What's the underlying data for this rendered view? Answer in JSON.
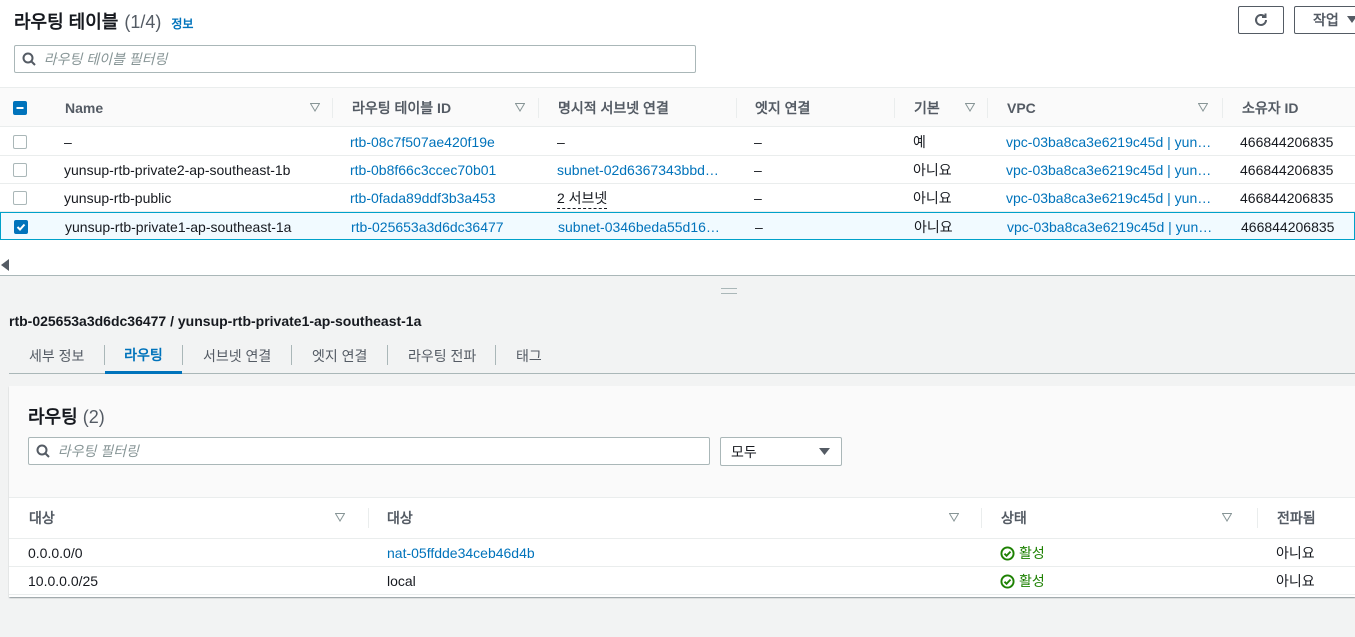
{
  "header": {
    "title": "라우팅 테이블",
    "count": "(1/4)",
    "info": "정보",
    "actions_label": "작업"
  },
  "filter": {
    "placeholder": "라우팅 테이블 필터링"
  },
  "table": {
    "columns": [
      "Name",
      "라우팅 테이블 ID",
      "명시적 서브넷 연결",
      "엣지 연결",
      "기본",
      "VPC",
      "소유자 ID"
    ],
    "rows": [
      {
        "name": "–",
        "id": "rtb-08c7f507ae420f19e",
        "subnet": "–",
        "edge": "–",
        "main": "예",
        "vpc": "vpc-03ba8ca3e6219c45d | yun…",
        "owner": "466844206835",
        "selected": false
      },
      {
        "name": "yunsup-rtb-private2-ap-southeast-1b",
        "id": "rtb-0b8f66c3ccec70b01",
        "subnet": "subnet-02d6367343bbd…",
        "edge": "–",
        "main": "아니요",
        "vpc": "vpc-03ba8ca3e6219c45d | yun…",
        "owner": "466844206835",
        "selected": false
      },
      {
        "name": "yunsup-rtb-public",
        "id": "rtb-0fada89ddf3b3a453",
        "subnet": "2 서브넷",
        "edge": "–",
        "main": "아니요",
        "vpc": "vpc-03ba8ca3e6219c45d | yun…",
        "owner": "466844206835",
        "selected": false
      },
      {
        "name": "yunsup-rtb-private1-ap-southeast-1a",
        "id": "rtb-025653a3d6dc36477",
        "subnet": "subnet-0346beda55d16…",
        "edge": "–",
        "main": "아니요",
        "vpc": "vpc-03ba8ca3e6219c45d | yun…",
        "owner": "466844206835",
        "selected": true
      }
    ]
  },
  "detail": {
    "title": "rtb-025653a3d6dc36477 / yunsup-rtb-private1-ap-southeast-1a",
    "tabs": [
      "세부 정보",
      "라우팅",
      "서브넷 연결",
      "엣지 연결",
      "라우팅 전파",
      "태그"
    ],
    "active_tab": 1
  },
  "routes": {
    "title": "라우팅",
    "count": "(2)",
    "filter_placeholder": "라우팅 필터링",
    "select_value": "모두",
    "columns": [
      "대상",
      "대상",
      "상태",
      "전파됨"
    ],
    "rows": [
      {
        "destination": "0.0.0.0/0",
        "target": "nat-05ffdde34ceb46d4b",
        "target_is_link": true,
        "status": "활성",
        "propagated": "아니요"
      },
      {
        "destination": "10.0.0.0/25",
        "target": "local",
        "target_is_link": false,
        "status": "활성",
        "propagated": "아니요"
      }
    ]
  },
  "colors": {
    "link": "#0073bb",
    "success": "#1d8102",
    "selected_border": "#00a1c9"
  }
}
